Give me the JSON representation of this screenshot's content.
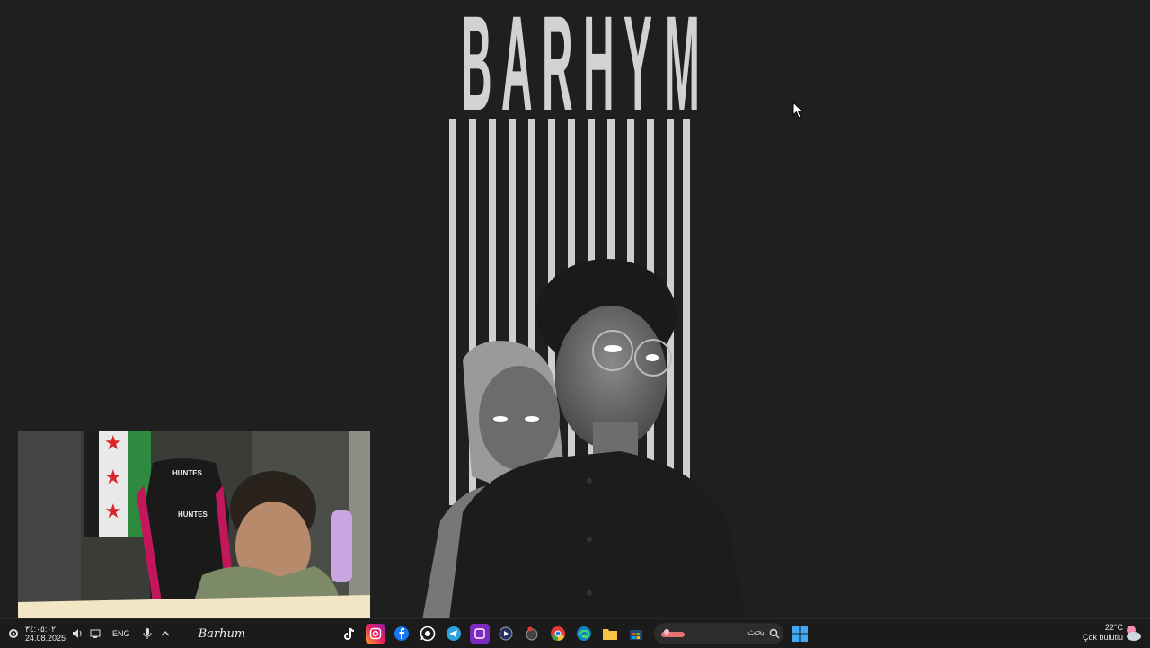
{
  "wallpaper": {
    "title_letters": [
      "B",
      "A",
      "R",
      "H",
      "Y",
      "M"
    ]
  },
  "webcam": {
    "chair_brand": "HUNTES",
    "chair_brand_back": "HUNTES",
    "signature": "Barhum"
  },
  "taskbar": {
    "date_top": "٣٤:٠٥:٠٢",
    "date": "24.08.2025",
    "language": "ENG",
    "search_placeholder": "بحث",
    "apps": [
      "tiktok-icon",
      "instagram-icon",
      "facebook-icon",
      "whatsapp-icon",
      "telegram-icon",
      "app-purple-icon",
      "media-player-icon",
      "game-icon",
      "chrome-icon",
      "edge-icon",
      "file-explorer-icon",
      "microsoft-store-icon"
    ],
    "weather": {
      "temperature": "22°C",
      "condition": "Çok bulutlu"
    }
  }
}
